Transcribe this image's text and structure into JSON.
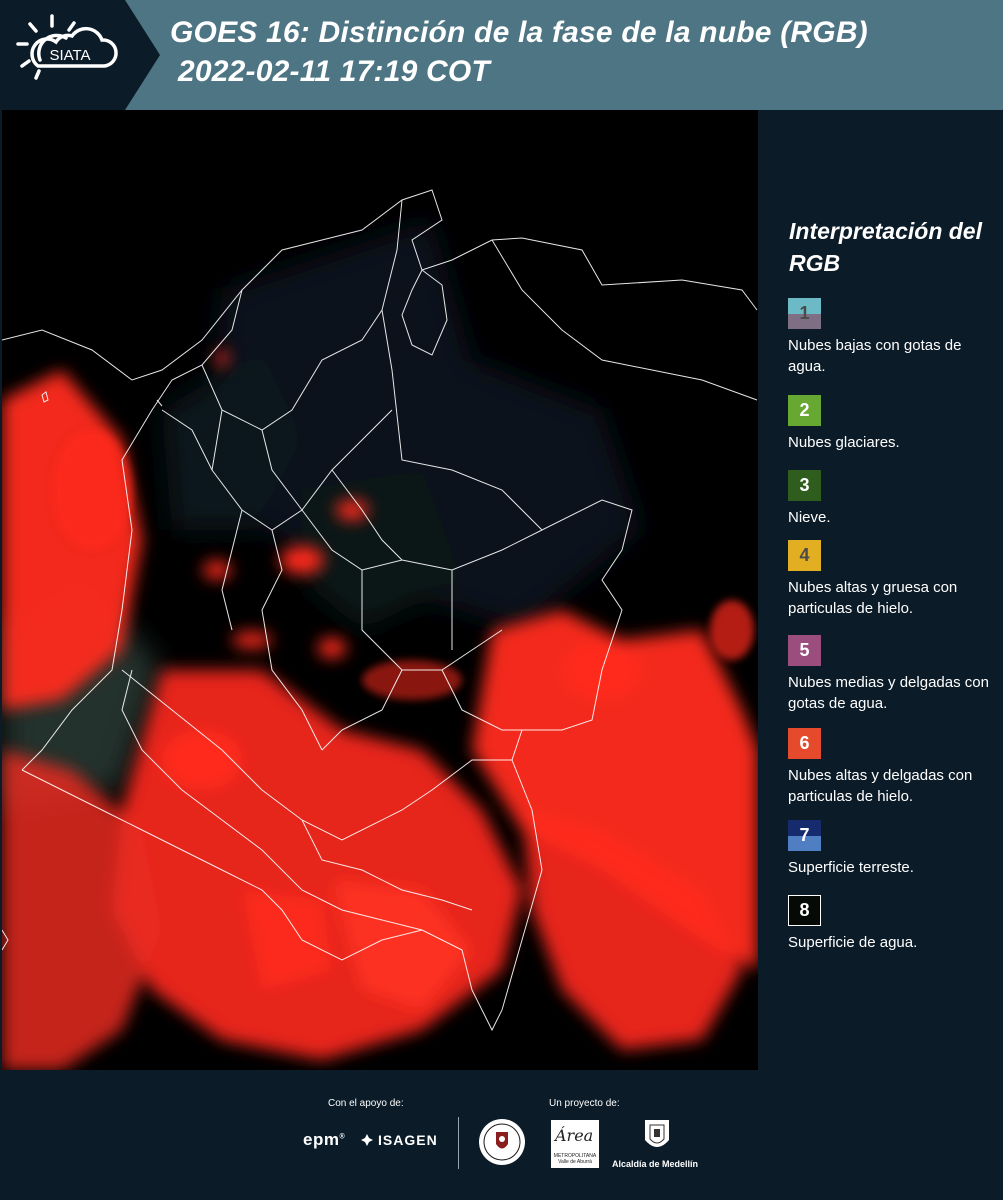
{
  "header": {
    "logo_text": "SIATA",
    "title_line1": "GOES 16: Distinción de la fase de la nube (RGB)",
    "title_line2": "2022-02-11 17:19 COT"
  },
  "legend": {
    "title": "Interpretación del RGB",
    "items": [
      {
        "num": "1",
        "label": "Nubes bajas con gotas de agua.",
        "color_top": "#6bbac6",
        "color_bottom": "#7e6f85",
        "num_color": "#4a4a4a"
      },
      {
        "num": "2",
        "label": "Nubes glaciares.",
        "color_top": "#67a833",
        "color_bottom": "#67a833",
        "num_color": "#ffffff"
      },
      {
        "num": "3",
        "label": "Nieve.",
        "color_top": "#2f5d1d",
        "color_bottom": "#2f5d1d",
        "num_color": "#ffffff"
      },
      {
        "num": "4",
        "label": "Nubes altas y gruesa con particulas de hielo.",
        "color_top": "#e2ae22",
        "color_bottom": "#e2ae22",
        "num_color": "#4a4a4a"
      },
      {
        "num": "5",
        "label": "Nubes medias y delgadas con gotas de agua.",
        "color_top": "#9b4e7d",
        "color_bottom": "#9b4e7d",
        "num_color": "#ffffff"
      },
      {
        "num": "6",
        "label": "Nubes altas y delgadas con particulas de hielo.",
        "color_top": "#e64a2c",
        "color_bottom": "#e64a2c",
        "num_color": "#ffffff"
      },
      {
        "num": "7",
        "label": "Superficie terreste.",
        "color_top": "#162a6e",
        "color_bottom": "#4f7ec3",
        "num_color": "#ffffff"
      },
      {
        "num": "8",
        "label": "Superficie de agua.",
        "color_top": "#050a06",
        "color_bottom": "#050a06",
        "num_color": "#ffffff"
      }
    ]
  },
  "footer": {
    "support_label": "Con el apoyo de:",
    "project_label": "Un proyecto de:",
    "epm": "epm",
    "isagen": "ISAGEN",
    "metro_script": "Área",
    "metro_sub": "METROPOLITANA Valle de Aburrá",
    "medellin": "Alcaldía de Medellín"
  },
  "colors": {
    "header_bg": "#4e7583",
    "panel_bg": "#0b1b27",
    "cloud_red": "#ff2a1e",
    "border_white": "#ffffff"
  }
}
